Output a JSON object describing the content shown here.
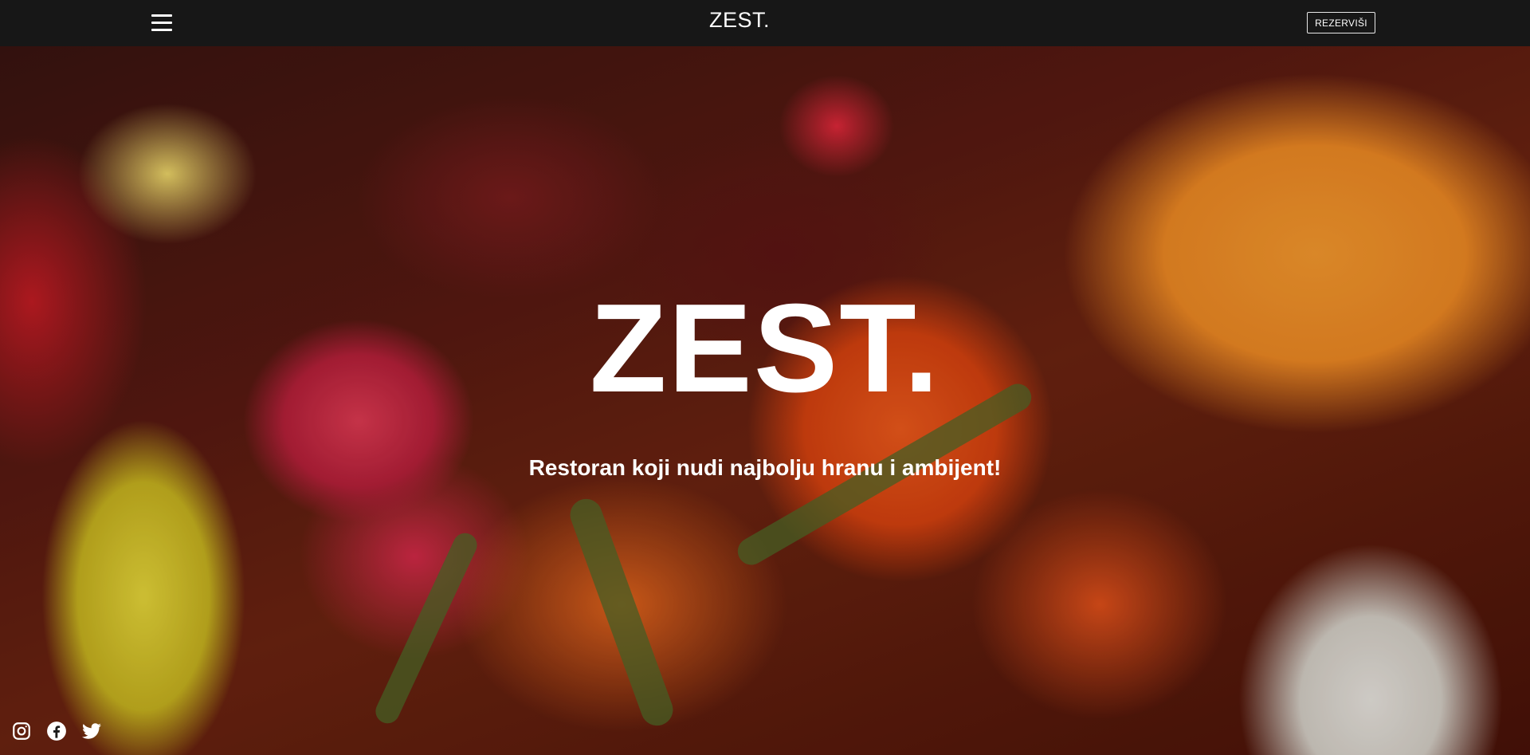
{
  "header": {
    "menu_icon": "hamburger-menu-icon",
    "brand": "ZEST.",
    "reserve_label": "REZERVIŠI"
  },
  "hero": {
    "title": "ZEST.",
    "subtitle": "Restoran koji nudi najbolju hranu i ambijent!"
  },
  "social": {
    "icons": [
      "instagram-icon",
      "facebook-icon",
      "twitter-icon"
    ]
  },
  "colors": {
    "header_bg": "#171717",
    "text": "#ffffff"
  }
}
